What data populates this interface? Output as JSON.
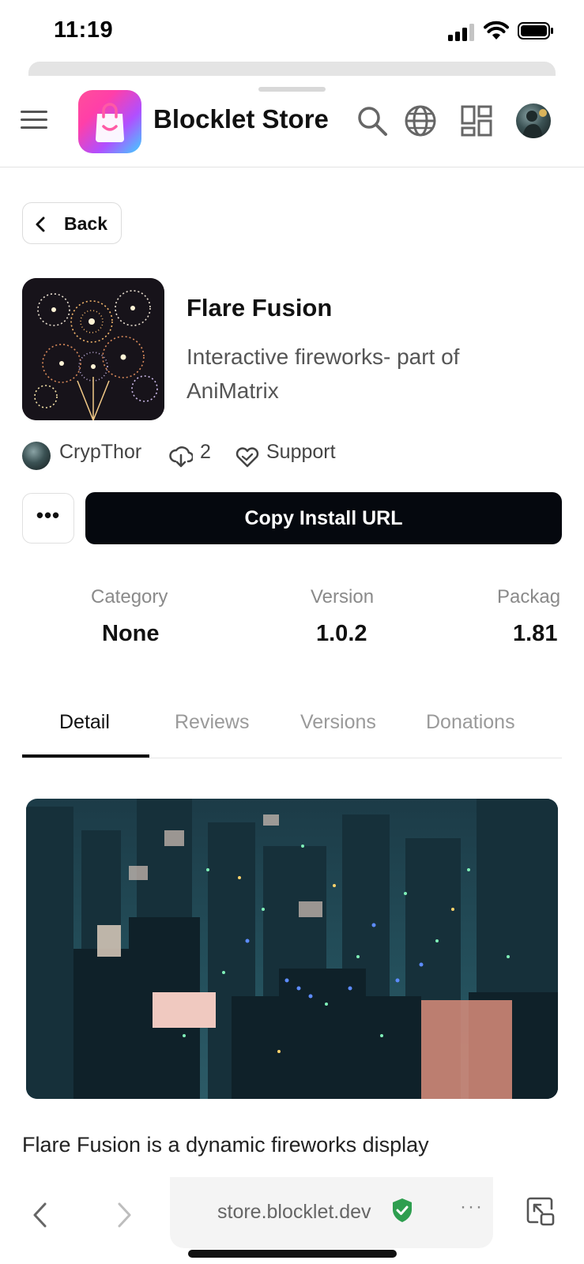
{
  "status_bar": {
    "time": "11:19"
  },
  "header": {
    "brand": "Blocklet Store",
    "icons": [
      "menu-icon",
      "search-icon",
      "globe-icon",
      "apps-grid-icon",
      "user-avatar"
    ]
  },
  "back": {
    "label": "Back"
  },
  "app": {
    "title": "Flare Fusion",
    "description": "Interactive fireworks- part of AniMatrix",
    "author": "CrypThor",
    "downloads": "2",
    "support_label": "Support",
    "more_label": "•••",
    "install_label": "Copy Install URL"
  },
  "stats": [
    {
      "label": "Category",
      "value": "None"
    },
    {
      "label": "Version",
      "value": "1.0.2"
    },
    {
      "label": "Packag",
      "value": "1.81"
    }
  ],
  "tabs": [
    {
      "label": "Detail",
      "active": true
    },
    {
      "label": "Reviews",
      "active": false
    },
    {
      "label": "Versions",
      "active": false
    },
    {
      "label": "Donations",
      "active": false
    }
  ],
  "detail": {
    "intro": "Flare Fusion is a dynamic fireworks display"
  },
  "browser": {
    "url": "store.blocklet.dev",
    "more": "···"
  },
  "colors": {
    "install_button": "#05080e",
    "secure_shield": "#2e9e4f",
    "brand_gradient_start": "#ff4f9a",
    "brand_gradient_end": "#3fd0ff"
  }
}
